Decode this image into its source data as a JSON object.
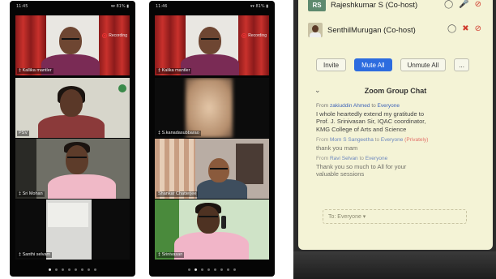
{
  "phone_a": {
    "status_left": "11:45",
    "status_right": "▾▾ 81% ▮",
    "pager_dots": 8,
    "active_dot": 0,
    "tiles": [
      {
        "label": "‡ Kallika mantler",
        "recording": "Recording"
      },
      {
        "label": "PSV",
        "active": true
      },
      {
        "label": "‡ Sri Mohan"
      },
      {
        "label": "‡ Santhi selvam"
      }
    ]
  },
  "phone_b": {
    "status_left": "11:46",
    "status_right": "▾▾ 81% ▮",
    "pager_dots": 8,
    "active_dot": 1,
    "tiles": [
      {
        "label": "‡ Kalika mantler",
        "recording": "Recording"
      },
      {
        "label": "‡ S.kanadasubbarao"
      },
      {
        "label": "Shankar Chatterjee"
      },
      {
        "label": "‡ Srinivasan",
        "active": true
      }
    ]
  },
  "zoom": {
    "participants": [
      {
        "avatar_text": "RS",
        "name": "Rajeshkumar S (Co-host)"
      },
      {
        "avatar_text": "",
        "name": "SenthilMurugan (Co-host)"
      }
    ],
    "buttons": {
      "invite": "Invite",
      "mute_all": "Mute All",
      "unmute_all": "Unmute All",
      "more": "..."
    },
    "chat_title": "Zoom Group Chat",
    "messages": [
      {
        "from_prefix": "From",
        "sender": "zakiuddin Ahmed",
        "to_word": "to",
        "recipient": "Everyone",
        "private_note": "",
        "lines": [
          "I whole heartedly extend my gratitude to",
          "Prof. J. Srinivasan Sir, IQAC coordinator,",
          "KMG College of Arts and Science"
        ]
      },
      {
        "from_prefix": "From",
        "sender": "Mom S Sangeetha",
        "to_word": "to",
        "recipient": "Everyone",
        "private_note": "(Privately)",
        "lines": [
          "thank you mam"
        ]
      },
      {
        "from_prefix": "From",
        "sender": "Ravi Selvan",
        "to_word": "to",
        "recipient": "Everyone",
        "private_note": "",
        "lines": [
          "Thank you so much to All for your",
          "valuable sessions"
        ]
      }
    ],
    "input_placeholder": "To: Everyone ▾"
  },
  "colors": {
    "active_border": "#39c45a",
    "zoom_blue": "#2d6cdf",
    "screen_bg": "#f4f3d6",
    "record_red": "#e33333"
  },
  "icons": [
    "record-icon",
    "mic-icon",
    "video-off-icon",
    "chevron-down-icon"
  ]
}
